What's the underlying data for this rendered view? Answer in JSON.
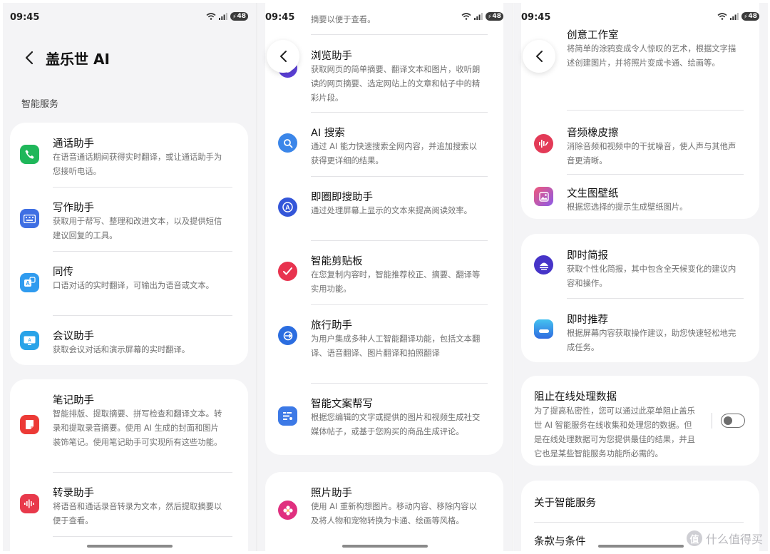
{
  "status": {
    "time": "09:45",
    "battery": "48"
  },
  "panel1": {
    "title": "盖乐世 AI",
    "section": "智能服务",
    "items": [
      {
        "title": "通话助手",
        "desc": "在语音通话期间获得实时翻译，或让通话助手为您接听电话。"
      },
      {
        "title": "写作助手",
        "desc": "获取用于帮写、整理和改进文本，以及提供短信建议回复的工具。"
      },
      {
        "title": "同传",
        "desc": "口语对话的实时翻译，可输出为语音或文本。"
      },
      {
        "title": "会议助手",
        "desc": "获取会议对话和演示屏幕的实时翻译。"
      },
      {
        "title": "笔记助手",
        "desc": "智能排版、提取摘要、拼写检查和翻译文本。转录和提取录音摘要。使用 AI 生成的封面和图片装饰笔记。使用笔记助手可实现所有这些功能。"
      },
      {
        "title": "转录助手",
        "desc": "将语音和通话录音转录为文本，然后提取摘要以便于查看。"
      }
    ]
  },
  "panel2": {
    "top_fragment": "摘要以便于查看。",
    "items": [
      {
        "title": "浏览助手",
        "desc": "获取网页的简单摘要、翻译文本和图片，收听朗读的网页摘要、选定网站上的文章和帖子中的精彩片段。"
      },
      {
        "title": "AI 搜索",
        "desc": "通过 AI 能力快速搜索全网内容，并追加搜索以获得更详细的结果。"
      },
      {
        "title": "即圈即搜助手",
        "desc": "通过处理屏幕上显示的文本来提高阅读效率。"
      },
      {
        "title": "智能剪贴板",
        "desc": "在您复制内容时，智能推荐校正、摘要、翻译等实用功能。"
      },
      {
        "title": "旅行助手",
        "desc": "为用户集成多种人工智能翻译功能，包括文本翻译、语音翻译、图片翻译和拍照翻译"
      },
      {
        "title": "智能文案帮写",
        "desc": "根据您编辑的文字或提供的图片和视频生成社交媒体帖子，或基于您购买的商品生成评论。"
      },
      {
        "title": "照片助手",
        "desc": "使用 AI 重新构想图片。移动内容、移除内容以及将人物和宠物转换为卡通、绘画等风格。"
      }
    ]
  },
  "panel3": {
    "items": [
      {
        "title": "创意工作室",
        "desc": "将简单的涂鸦变成令人惊叹的艺术，根据文字描述创建图片，并将照片变成卡通、绘画等。"
      },
      {
        "title": "音频橡皮擦",
        "desc": "消除音频和视频中的干扰噪音，使人声与其他声音更清晰。"
      },
      {
        "title": "文生图壁纸",
        "desc": "根据您选择的提示生成壁纸图片。"
      },
      {
        "title": "即时简报",
        "desc": "获取个性化简报，其中包含全天候变化的建议内容和操作。"
      },
      {
        "title": "即时推荐",
        "desc": "根据屏幕内容获取操作建议，助您快速轻松地完成任务。"
      }
    ],
    "privacy": {
      "title": "阻止在线处理数据",
      "desc": "为了提高私密性，您可以通过此菜单阻止盖乐世 AI 智能服务在线收集和处理您的数据。但是在线处理数据可为您提供最佳的结果，并且它也是某些智能服务功能所必需的。"
    },
    "about": "关于智能服务",
    "terms": "条款与条件"
  },
  "watermark": "什么值得买",
  "watermark_icon": "值",
  "icons": [
    "call-icon",
    "keyboard-icon",
    "translate-icon",
    "meeting-icon",
    "note-icon",
    "transcribe-icon",
    "browser-icon",
    "search-icon",
    "circle-search-icon",
    "clipboard-icon",
    "travel-icon",
    "writing-icon",
    "photo-icon",
    "creative-icon",
    "audio-eraser-icon",
    "wallpaper-icon",
    "briefing-icon",
    "suggestion-icon"
  ],
  "colors": {
    "background": "#f4f4f6",
    "card": "#ffffff",
    "accent_green": "#1fb75a",
    "accent_blue": "#3f6fe3",
    "accent_red": "#e8394b"
  }
}
